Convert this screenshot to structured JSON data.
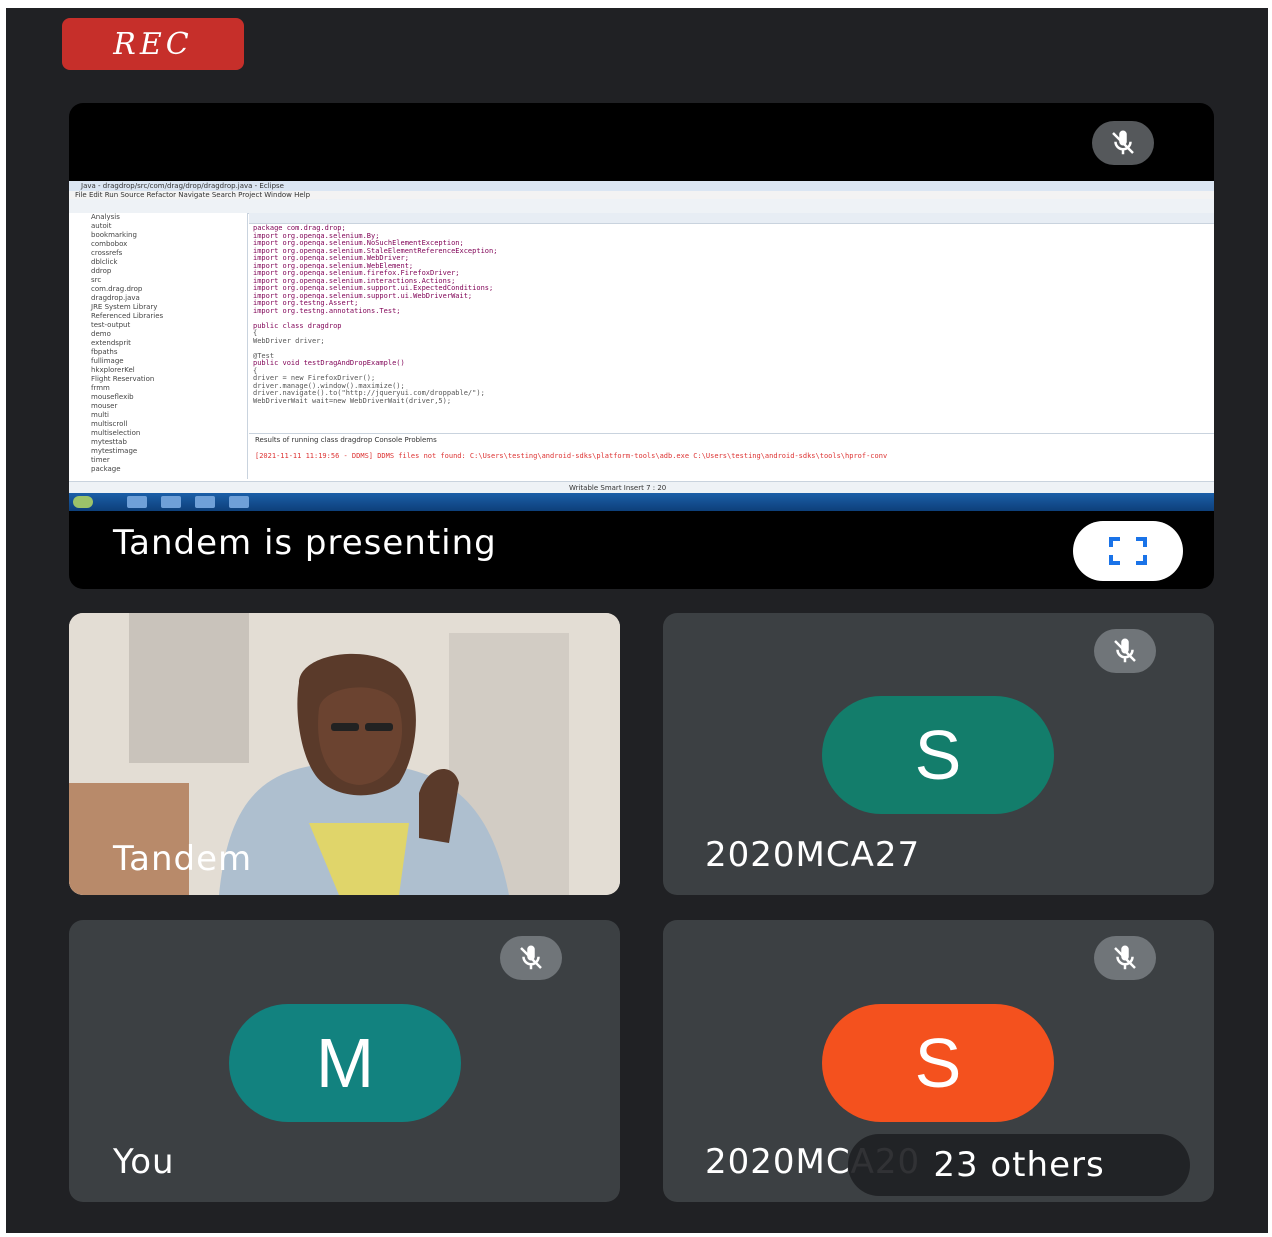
{
  "rec_label": "REC",
  "presentation": {
    "label": "Tandem is presenting",
    "screen": {
      "window_title": "Java - dragdrop/src/com/drag/drop/dragdrop.java - Eclipse",
      "menu": "File  Edit  Run  Source  Refactor  Navigate  Search  Project  Window  Help",
      "explorer_items": [
        "Analysis",
        "autoit",
        "bookmarking",
        "combobox",
        "crossrefs",
        "dblclick",
        "ddrop",
        "src",
        "com.drag.drop",
        "dragdrop.java",
        "JRE System Library",
        "Referenced Libraries",
        "test-output",
        "demo",
        "extendsprit",
        "fbpaths",
        "fullimage",
        "hkxplorerKel",
        "Flight Reservation",
        "frmm",
        "mouseflexib",
        "mouser",
        "multi",
        "multiscroll",
        "multiselection",
        "mytesttab",
        "mytestimage",
        "timer",
        "package"
      ],
      "code_lines": [
        "package com.drag.drop;",
        "import org.openqa.selenium.By;",
        "import org.openqa.selenium.NoSuchElementException;",
        "import org.openqa.selenium.StaleElementReferenceException;",
        "import org.openqa.selenium.WebDriver;",
        "import org.openqa.selenium.WebElement;",
        "import org.openqa.selenium.firefox.FirefoxDriver;",
        "import org.openqa.selenium.interactions.Actions;",
        "import org.openqa.selenium.support.ui.ExpectedConditions;",
        "import org.openqa.selenium.support.ui.WebDriverWait;",
        "import org.testng.Assert;",
        "import org.testng.annotations.Test;",
        "",
        "public class dragdrop",
        "{",
        "WebDriver driver;",
        "",
        "@Test",
        "public void testDragAndDropExample()",
        "{",
        "    driver = new FirefoxDriver();",
        "    driver.manage().window().maximize();",
        "    driver.navigate().to(\"http://jqueryui.com/droppable/\");",
        "    WebDriverWait wait=new WebDriverWait(driver,5);"
      ],
      "console_tabs": "Results of running class dragdrop   Console   Problems",
      "console_error": "[2021-11-11 11:19:56 - DDMS] DDMS files not found: C:\\Users\\testing\\android-sdks\\platform-tools\\adb.exe C:\\Users\\testing\\android-sdks\\tools\\hprof-conv",
      "status": "Writable    Smart Insert    7 : 20"
    }
  },
  "participants": [
    {
      "name": "Tandem",
      "video": true
    },
    {
      "name": "2020MCA27",
      "initial": "S",
      "avatar_color": "#137d6b"
    },
    {
      "name": "You",
      "initial": "M",
      "avatar_color": "#12827f"
    },
    {
      "name": "2020MCA20",
      "initial": "S",
      "avatar_color": "#f4511e"
    }
  ],
  "others_label": "23 others",
  "colors": {
    "background": "#202124",
    "tile": "#3c4043",
    "rec": "#c62f2a"
  }
}
